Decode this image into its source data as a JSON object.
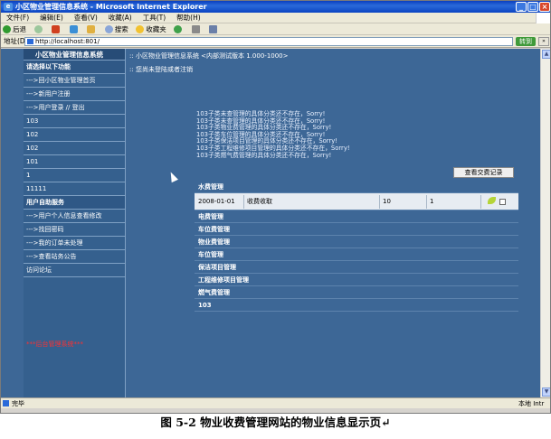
{
  "window": {
    "title": "小区物业管理信息系统 - Microsoft Internet Explorer",
    "min": "_",
    "max": "□",
    "close": "×"
  },
  "menu": [
    "文件(F)",
    "编辑(E)",
    "查看(V)",
    "收藏(A)",
    "工具(T)",
    "帮助(H)"
  ],
  "toolbar": {
    "back": "后退",
    "search": "搜索",
    "favorites": "收藏夹"
  },
  "address": {
    "label": "地址(D)",
    "url": "http://localhost:801/",
    "go": "转到",
    "links": "»"
  },
  "sidebar": {
    "title": "小区物业管理信息系统",
    "section1": "请选择以下功能",
    "items1": [
      "--->回小区物业管理首页",
      "--->新用户注册",
      "--->用户登录 // 登出",
      "103",
      "102",
      "102",
      "101",
      "1",
      "11111"
    ],
    "section2": "用户自助服务",
    "items2": [
      "--->用户个人信息查看修改",
      "--->找回密码",
      "--->我的订单未处理",
      "--->查看站务公告",
      "访问论坛"
    ],
    "admin_link": "***后台管理系统***"
  },
  "main": {
    "crumb": ":: 小区物业管理信息系统 <内部测试版本 1.000-1000>",
    "login_status": ":: 您尚未登陆或者注销",
    "messages": [
      "103子类未查管理的具体分类还不存在，Sorry!",
      "103子类未查管理的具体分类还不存在，Sorry!",
      "103子类物业费管理的具体分类还不存在，Sorry!",
      "103子类车位管理的具体分类还不存在，Sorry!",
      "103子类保洁项目管理的具体分类还不存在，Sorry!",
      "103子类工程维修项目管理的具体分类还不存在，Sorry!",
      "103子类燃气费管理的具体分类还不存在，Sorry!"
    ],
    "view_records_button": "查看交费记录",
    "categories": [
      {
        "name": "水费管理",
        "row": {
          "date": "2008-01-01",
          "type": "收费收取",
          "qty": "10",
          "num": "1"
        }
      },
      {
        "name": "电费管理"
      },
      {
        "name": "车位费管理"
      },
      {
        "name": "物业费管理"
      },
      {
        "name": "车位管理"
      },
      {
        "name": "保洁项目管理"
      },
      {
        "name": "工程维修项目管理"
      },
      {
        "name": "燃气费管理"
      },
      {
        "name": "103"
      }
    ]
  },
  "status": {
    "left": "完毕",
    "right": "本地 Intr"
  },
  "caption": "图 5-2  物业收费管理网站的物业信息显示页↵"
}
